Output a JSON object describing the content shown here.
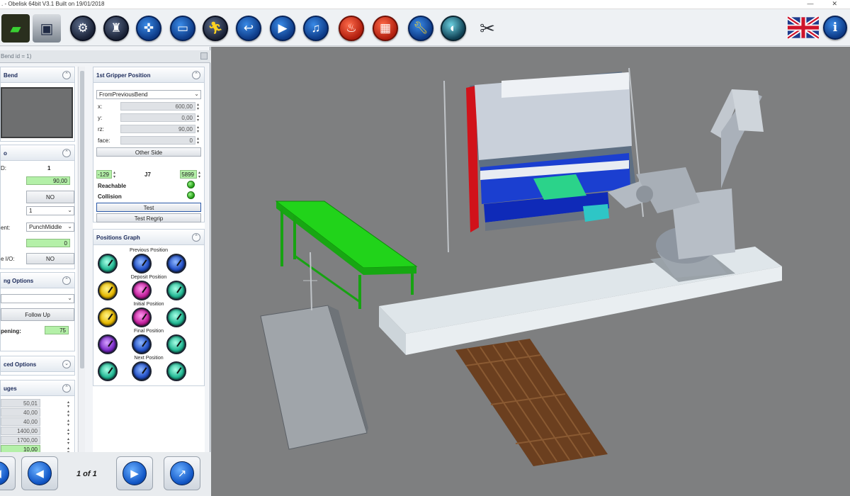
{
  "window": {
    "title": ". - Obelisk 64bit V3.1 Built on 19/01/2018",
    "min": "—",
    "close": "✕"
  },
  "toolbar": {
    "icons": [
      "open-folder-icon",
      "save-disk-icon",
      "machine-setup-icon",
      "robot-icon",
      "gamepad-icon",
      "camera-icon",
      "run-icon",
      "return-icon",
      "play-icon",
      "music-icon",
      "fire-icon",
      "brick-icon",
      "wrench-icon",
      "globe-icon",
      "tools-icon",
      "uk-flag-icon",
      "info-icon"
    ]
  },
  "panel": {
    "header": "Bend id = 1)",
    "left": {
      "bend_section": "Bend",
      "info_section": "o",
      "id_label": "D:",
      "id_value": "1",
      "angle_value": "90,00",
      "no_btn": "NO",
      "select_1": "1",
      "point_label": "ent:",
      "point_value": "PunchMiddle",
      "zero_value": "0",
      "io_label": "e I/O:",
      "io_value": "NO",
      "options_section": "ng Options",
      "follow_up": "Follow Up",
      "opening_label": "pening:",
      "opening_value": "75",
      "advanced_section": "ced Options",
      "gauges_section": "uges",
      "gauge_values": [
        "50,01",
        "40,00",
        "40,00",
        "1400,00",
        "1700,00",
        "10,00"
      ]
    },
    "right": {
      "gripper_section": "1st Gripper Position",
      "gripper_mode": "FromPreviousBend",
      "x_label": "x:",
      "x_value": "600,00",
      "y_label": "y:",
      "y_value": "0,00",
      "rz_label": "rz:",
      "rz_value": "90,00",
      "face_label": "face:",
      "face_value": "0",
      "other_side": "Other Side",
      "j_left_value": "-129",
      "j_label": "J7",
      "j_right_value": "5899",
      "reachable_label": "Reachable",
      "collision_label": "Collision",
      "test_btn": "Test",
      "test_regrip_btn": "Test Regrip",
      "graph_section": "Positions Graph",
      "graph_rows": [
        "Previous Position",
        "Deposit Position",
        "Initial Position",
        "Final Position",
        "Next Position"
      ]
    },
    "status": {
      "reachable": "#2fb81e",
      "collision": "#2fb81e"
    },
    "page_indicator": "1 of 1"
  },
  "colors": {
    "viewport_bg": "#7e7f80",
    "table_green": "#21d31a",
    "robot_gray": "#aeb4bd",
    "press_red": "#d1121a",
    "press_blue": "#1b3fd0",
    "pallet_brown": "#6b3f1f"
  }
}
